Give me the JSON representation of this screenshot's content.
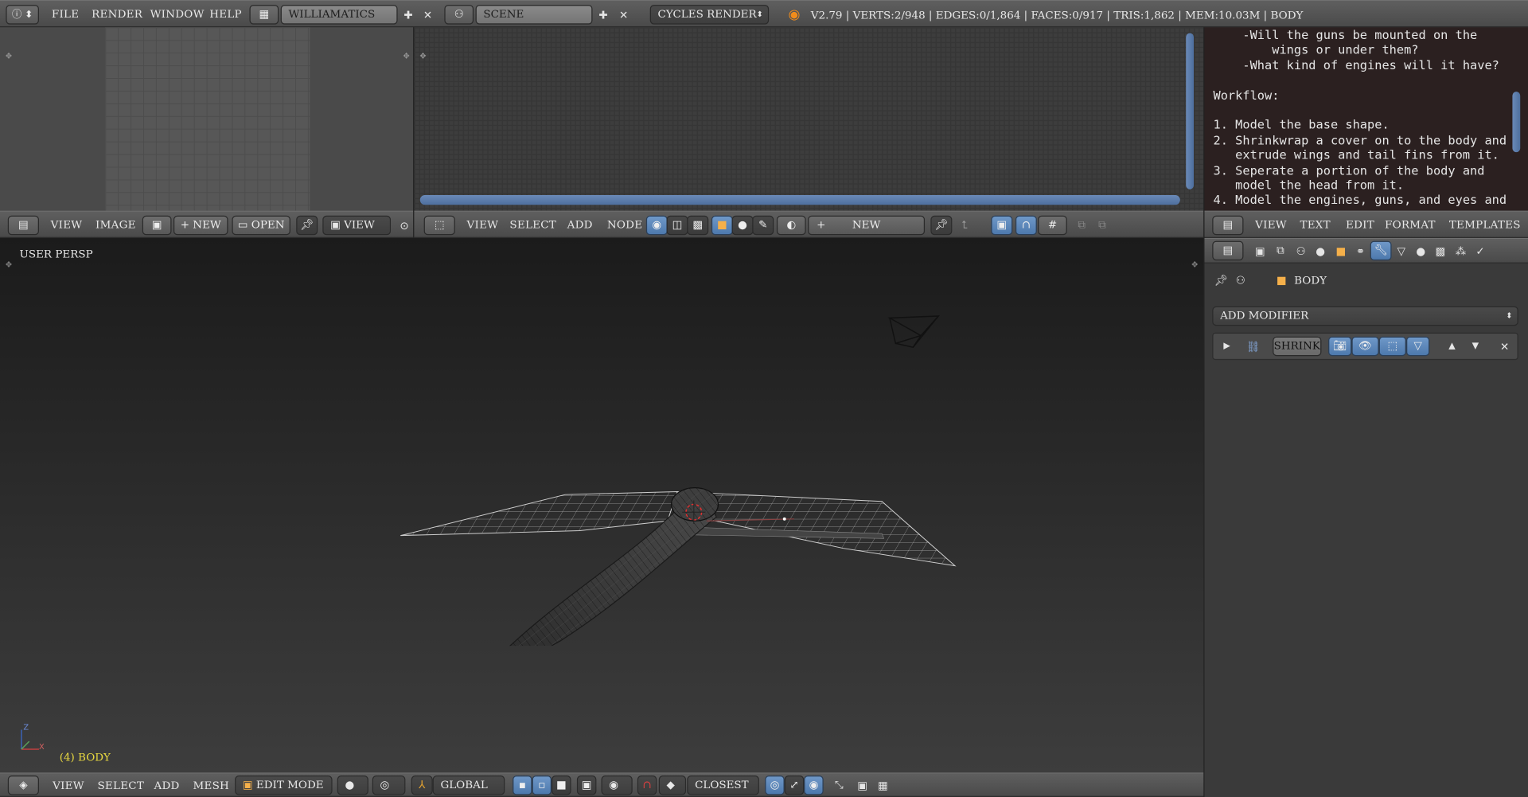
{
  "topbar": {
    "info_icon": "info-icon",
    "menus": [
      "FILE",
      "RENDER",
      "WINDOW",
      "HELP"
    ],
    "layout_name": "WILLIAMATICS",
    "scene_name": "SCENE",
    "render_engine": "CYCLES RENDER",
    "stats": "V2.79 | VERTS:2/948 | EDGES:0/1,864 | FACES:0/917 | TRIS:1,862 | MEM:10.03M | BODY"
  },
  "image_editor": {
    "menus": [
      "VIEW",
      "IMAGE"
    ],
    "new_label": "NEW",
    "open_label": "OPEN",
    "view_label": "VIEW"
  },
  "node_editor": {
    "menus": [
      "VIEW",
      "SELECT",
      "ADD",
      "NODE"
    ],
    "new_label": "NEW"
  },
  "text_editor": {
    "lines": [
      "    -Will the guns be mounted on the",
      "        wings or under them?",
      "    -What kind of engines will it have?",
      "",
      "Workflow:",
      "",
      "1. Model the base shape.",
      "2. Shrinkwrap a cover on to the body and",
      "   extrude wings and tail fins from it.",
      "3. Seperate a portion of the body and",
      "   model the head from it.",
      "4. Model the engines, guns, and eyes and"
    ],
    "menus": [
      "VIEW",
      "TEXT",
      "EDIT",
      "FORMAT",
      "TEMPLATES"
    ]
  },
  "viewport": {
    "view_label": "USER PERSP",
    "object_label": "(4) BODY",
    "axis_x": "X",
    "axis_z": "Z"
  },
  "viewport_header": {
    "menus": [
      "VIEW",
      "SELECT",
      "ADD",
      "MESH"
    ],
    "mode": "EDIT MODE",
    "orientation": "GLOBAL",
    "snap_target": "CLOSEST"
  },
  "properties": {
    "object_name": "BODY",
    "add_modifier_label": "ADD MODIFIER",
    "modifier_name": "SHRINK"
  },
  "colors": {
    "accent_blue": "#5680c2",
    "object_orange": "#e8a33c",
    "text_bg": "#2b2020",
    "viewport_top": "#1b1b1b",
    "viewport_bottom": "#3d3d3d"
  }
}
